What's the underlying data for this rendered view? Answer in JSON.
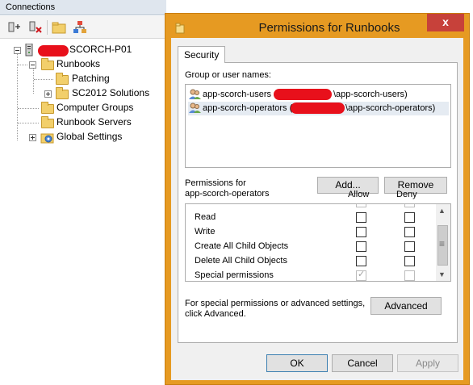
{
  "connections": {
    "header": "Connections",
    "toolbar": [
      "connect-icon",
      "disconnect-icon",
      "new-folder-icon",
      "runbook-designer-icon"
    ],
    "tree": {
      "server": "SCORCH-P01",
      "runbooks": "Runbooks",
      "patching": "Patching",
      "sc2012": "SC2012 Solutions",
      "computer_groups": "Computer Groups",
      "runbook_servers": "Runbook Servers",
      "global_settings": "Global Settings"
    }
  },
  "dialog": {
    "title": "Permissions for Runbooks",
    "close": "x",
    "tab": "Security",
    "group_label": "Group or user names:",
    "users": [
      {
        "prefix": "app-scorch-users",
        "suffix": "\\app-scorch-users)"
      },
      {
        "prefix": "app-scorch-operators (",
        "suffix": "\\app-scorch-operators)"
      }
    ],
    "add_button": "Add...",
    "remove_button": "Remove",
    "permissions_for_line1": "Permissions for",
    "permissions_for_line2": "app-scorch-operators",
    "allow_header": "Allow",
    "deny_header": "Deny",
    "permissions": [
      {
        "name": "Read",
        "allow": false,
        "deny": false
      },
      {
        "name": "Write",
        "allow": false,
        "deny": false
      },
      {
        "name": "Create All Child Objects",
        "allow": false,
        "deny": false
      },
      {
        "name": "Delete All Child Objects",
        "allow": false,
        "deny": false
      },
      {
        "name": "Special permissions",
        "allow": true,
        "deny": false
      }
    ],
    "advanced_note_line1": "For special permissions or advanced settings,",
    "advanced_note_line2": "click Advanced.",
    "advanced_button": "Advanced",
    "ok_button": "OK",
    "cancel_button": "Cancel",
    "apply_button": "Apply"
  },
  "colors": {
    "title_bar": "#e69a22",
    "close_button": "#c7413a",
    "redaction": "#e8101b",
    "selected_row": "#e5ebf2"
  }
}
